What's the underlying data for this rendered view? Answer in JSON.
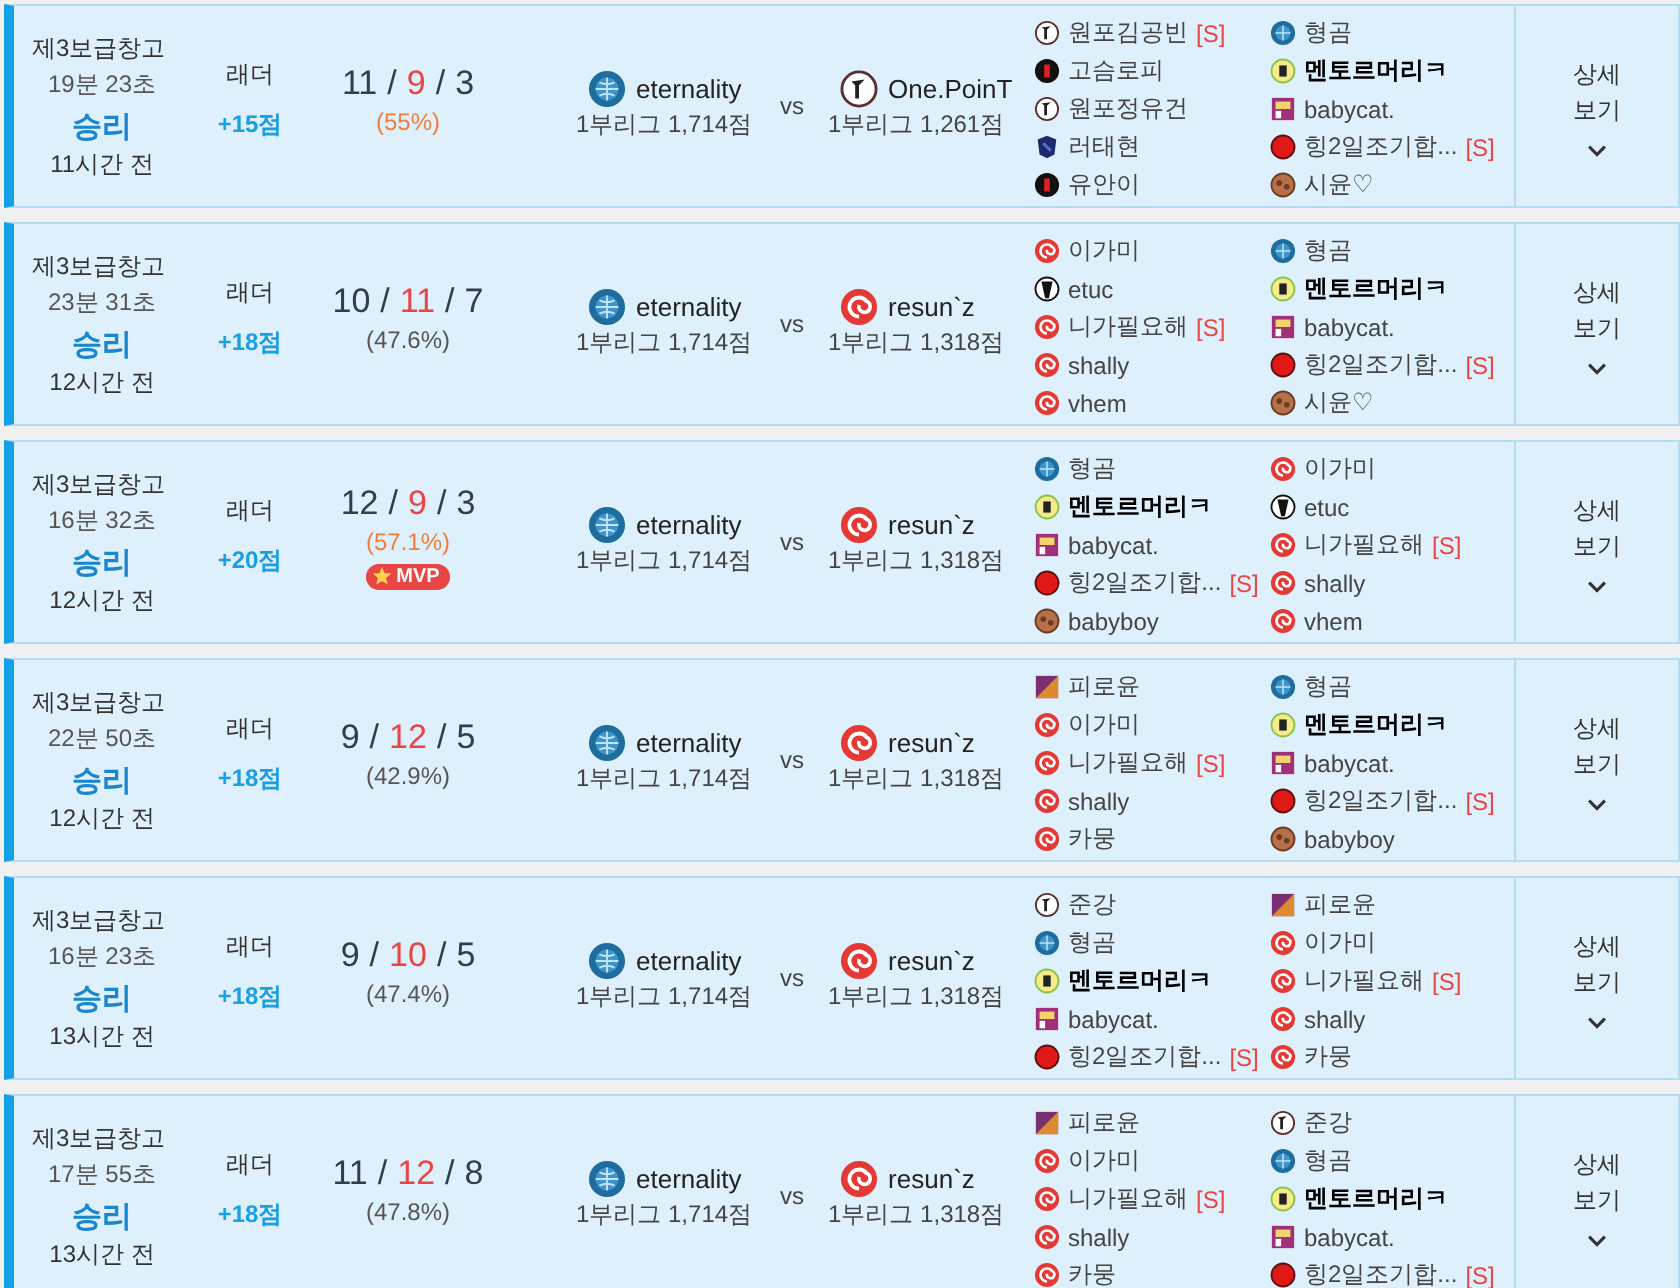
{
  "matches": [
    {
      "map": "제3보급창고",
      "duration": "19분 23초",
      "result": "승리",
      "ago": "11시간 전",
      "mode": "래더",
      "points": "+15점",
      "kda": [
        "11",
        "/",
        "9",
        "/",
        "3"
      ],
      "share": "(55%)",
      "highlight": true,
      "teams": [
        {
          "kind": "globe",
          "name": "eternality",
          "league": "1부리그 1,714점"
        },
        {
          "kind": "figure",
          "name": "One.PoinT",
          "league": "1부리그 1,261점"
        }
      ],
      "vs": "vs",
      "players": [
        [
          {
            "kind": "figure",
            "name": "원포김공빈",
            "tag": "[S]",
            "bold": false
          },
          {
            "kind": "blackred",
            "name": "고슴로피",
            "bold": false
          },
          {
            "kind": "figure",
            "name": "원포정유건",
            "bold": false
          },
          {
            "kind": "navy",
            "name": "러태현",
            "bold": false
          },
          {
            "kind": "blackred",
            "name": "유안이",
            "bold": false
          }
        ],
        [
          {
            "kind": "globe",
            "name": "형곰",
            "bold": false
          },
          {
            "kind": "yellow",
            "name": "멘토르머리ㅋ",
            "bold": true
          },
          {
            "kind": "pink",
            "name": "babycat.",
            "bold": false
          },
          {
            "kind": "reddot",
            "name": "힝2일조기합...",
            "tag": "[S]",
            "bold": false
          },
          {
            "kind": "brown",
            "name": "시윤♡",
            "bold": false
          }
        ]
      ],
      "detail": "상세 보기"
    },
    {
      "map": "제3보급창고",
      "duration": "23분 31초",
      "result": "승리",
      "ago": "12시간 전",
      "mode": "래더",
      "points": "+18점",
      "kda": [
        "10",
        "/",
        "11",
        "/",
        "7"
      ],
      "share": "(47.6%)",
      "highlight": false,
      "teams": [
        {
          "kind": "globe",
          "name": "eternality",
          "league": "1부리그 1,714점"
        },
        {
          "kind": "swirl",
          "name": "resun`z",
          "league": "1부리그 1,318점"
        }
      ],
      "vs": "vs",
      "players": [
        [
          {
            "kind": "swirl",
            "name": "이가미",
            "bold": false
          },
          {
            "kind": "bw",
            "name": "etuc",
            "bold": false
          },
          {
            "kind": "swirl",
            "name": "니가필요해",
            "tag": "[S]",
            "bold": false
          },
          {
            "kind": "swirl",
            "name": "shally",
            "bold": false
          },
          {
            "kind": "swirl",
            "name": "vhem",
            "bold": false
          }
        ],
        [
          {
            "kind": "globe",
            "name": "형곰",
            "bold": false
          },
          {
            "kind": "yellow",
            "name": "멘토르머리ㅋ",
            "bold": true
          },
          {
            "kind": "pink",
            "name": "babycat.",
            "bold": false
          },
          {
            "kind": "reddot",
            "name": "힝2일조기합...",
            "tag": "[S]",
            "bold": false
          },
          {
            "kind": "brown",
            "name": "시윤♡",
            "bold": false
          }
        ]
      ],
      "detail": "상세 보기"
    },
    {
      "map": "제3보급창고",
      "duration": "16분 32초",
      "result": "승리",
      "ago": "12시간 전",
      "mode": "래더",
      "points": "+20점",
      "kda": [
        "12",
        "/",
        "9",
        "/",
        "3"
      ],
      "share": "(57.1%)",
      "highlight": true,
      "badge": "MVP",
      "teams": [
        {
          "kind": "globe",
          "name": "eternality",
          "league": "1부리그 1,714점"
        },
        {
          "kind": "swirl",
          "name": "resun`z",
          "league": "1부리그 1,318점"
        }
      ],
      "vs": "vs",
      "players": [
        [
          {
            "kind": "globe",
            "name": "형곰",
            "bold": false
          },
          {
            "kind": "yellow",
            "name": "멘토르머리ㅋ",
            "bold": true
          },
          {
            "kind": "pink",
            "name": "babycat.",
            "bold": false
          },
          {
            "kind": "reddot",
            "name": "힝2일조기합...",
            "tag": "[S]",
            "bold": false
          },
          {
            "kind": "brown",
            "name": "babyboy",
            "bold": false
          }
        ],
        [
          {
            "kind": "swirl",
            "name": "이가미",
            "bold": false
          },
          {
            "kind": "bw",
            "name": "etuc",
            "bold": false
          },
          {
            "kind": "swirl",
            "name": "니가필요해",
            "tag": "[S]",
            "bold": false
          },
          {
            "kind": "swirl",
            "name": "shally",
            "bold": false
          },
          {
            "kind": "swirl",
            "name": "vhem",
            "bold": false
          }
        ]
      ],
      "detail": "상세 보기"
    },
    {
      "map": "제3보급창고",
      "duration": "22분 50초",
      "result": "승리",
      "ago": "12시간 전",
      "mode": "래더",
      "points": "+18점",
      "kda": [
        "9",
        "/",
        "12",
        "/",
        "5"
      ],
      "share": "(42.9%)",
      "highlight": false,
      "teams": [
        {
          "kind": "globe",
          "name": "eternality",
          "league": "1부리그 1,714점"
        },
        {
          "kind": "swirl",
          "name": "resun`z",
          "league": "1부리그 1,318점"
        }
      ],
      "vs": "vs",
      "players": [
        [
          {
            "kind": "square",
            "name": "피로윤",
            "bold": false
          },
          {
            "kind": "swirl",
            "name": "이가미",
            "bold": false
          },
          {
            "kind": "swirl",
            "name": "니가필요해",
            "tag": "[S]",
            "bold": false
          },
          {
            "kind": "swirl",
            "name": "shally",
            "bold": false
          },
          {
            "kind": "swirl",
            "name": "카뭉",
            "bold": false
          }
        ],
        [
          {
            "kind": "globe",
            "name": "형곰",
            "bold": false
          },
          {
            "kind": "yellow",
            "name": "멘토르머리ㅋ",
            "bold": true
          },
          {
            "kind": "pink",
            "name": "babycat.",
            "bold": false
          },
          {
            "kind": "reddot",
            "name": "힝2일조기합...",
            "tag": "[S]",
            "bold": false
          },
          {
            "kind": "brown",
            "name": "babyboy",
            "bold": false
          }
        ]
      ],
      "detail": "상세 보기"
    },
    {
      "map": "제3보급창고",
      "duration": "16분 23초",
      "result": "승리",
      "ago": "13시간 전",
      "mode": "래더",
      "points": "+18점",
      "kda": [
        "9",
        "/",
        "10",
        "/",
        "5"
      ],
      "share": "(47.4%)",
      "highlight": false,
      "teams": [
        {
          "kind": "globe",
          "name": "eternality",
          "league": "1부리그 1,714점"
        },
        {
          "kind": "swirl",
          "name": "resun`z",
          "league": "1부리그 1,318점"
        }
      ],
      "vs": "vs",
      "players": [
        [
          {
            "kind": "figure",
            "name": "준강",
            "bold": false
          },
          {
            "kind": "globe",
            "name": "형곰",
            "bold": false
          },
          {
            "kind": "yellow",
            "name": "멘토르머리ㅋ",
            "bold": true
          },
          {
            "kind": "pink",
            "name": "babycat.",
            "bold": false
          },
          {
            "kind": "reddot",
            "name": "힝2일조기합...",
            "tag": "[S]",
            "bold": false
          }
        ],
        [
          {
            "kind": "square",
            "name": "피로윤",
            "bold": false
          },
          {
            "kind": "swirl",
            "name": "이가미",
            "bold": false
          },
          {
            "kind": "swirl",
            "name": "니가필요해",
            "tag": "[S]",
            "bold": false
          },
          {
            "kind": "swirl",
            "name": "shally",
            "bold": false
          },
          {
            "kind": "swirl",
            "name": "카뭉",
            "bold": false
          }
        ]
      ],
      "detail": "상세 보기"
    },
    {
      "map": "제3보급창고",
      "duration": "17분 55초",
      "result": "승리",
      "ago": "13시간 전",
      "mode": "래더",
      "points": "+18점",
      "kda": [
        "11",
        "/",
        "12",
        "/",
        "8"
      ],
      "share": "(47.8%)",
      "highlight": false,
      "teams": [
        {
          "kind": "globe",
          "name": "eternality",
          "league": "1부리그 1,714점"
        },
        {
          "kind": "swirl",
          "name": "resun`z",
          "league": "1부리그 1,318점"
        }
      ],
      "vs": "vs",
      "players": [
        [
          {
            "kind": "square",
            "name": "피로윤",
            "bold": false
          },
          {
            "kind": "swirl",
            "name": "이가미",
            "bold": false
          },
          {
            "kind": "swirl",
            "name": "니가필요해",
            "tag": "[S]",
            "bold": false
          },
          {
            "kind": "swirl",
            "name": "shally",
            "bold": false
          },
          {
            "kind": "swirl",
            "name": "카뭉",
            "bold": false
          }
        ],
        [
          {
            "kind": "figure",
            "name": "준강",
            "bold": false
          },
          {
            "kind": "globe",
            "name": "형곰",
            "bold": false
          },
          {
            "kind": "yellow",
            "name": "멘토르머리ㅋ",
            "bold": true
          },
          {
            "kind": "pink",
            "name": "babycat.",
            "bold": false
          },
          {
            "kind": "reddot",
            "name": "힝2일조기합...",
            "tag": "[S]",
            "bold": false
          }
        ]
      ],
      "detail": "상세 보기"
    }
  ]
}
